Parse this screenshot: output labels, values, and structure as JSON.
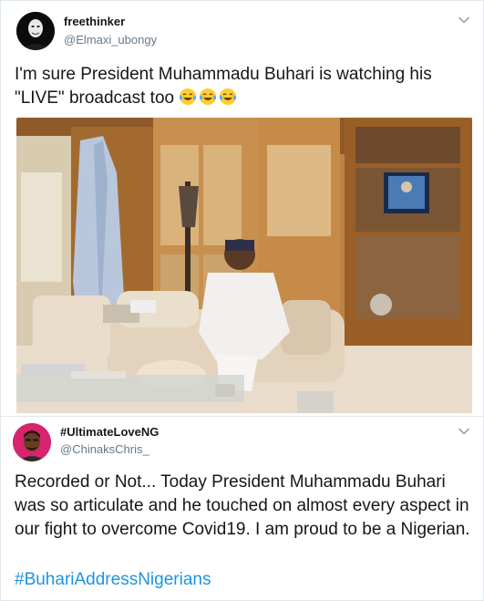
{
  "tweet1": {
    "display_name": "freethinker",
    "handle": "@Elmaxi_ubongy",
    "text": "I'm sure President Muhammadu Buhari is watching his \"LIVE\" broadcast too",
    "emoji_names": [
      "tears-of-joy-emoji",
      "tears-of-joy-emoji",
      "tears-of-joy-emoji"
    ]
  },
  "tweet2": {
    "display_name": "#UltimateLoveNG",
    "handle": "@ChinaksChris_",
    "text": "Recorded or Not... Today President Muhammadu Buhari was so articulate and he touched on almost every aspect in our fight to overcome Covid19. I am proud to be a Nigerian.",
    "hashtag": "#BuhariAddressNigerians"
  },
  "icons": {
    "caret": "chevron-down-icon"
  },
  "colors": {
    "hashtag": "#1b95e0",
    "handle": "#657786",
    "border": "#e1e8ed",
    "avatar2": "#d6246e"
  }
}
